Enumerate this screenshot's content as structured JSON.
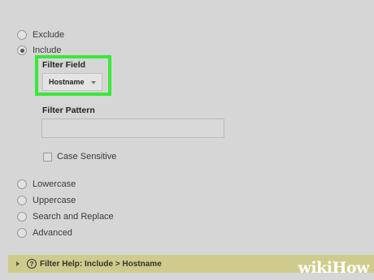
{
  "mode_options": [
    {
      "label": "Exclude",
      "selected": false
    },
    {
      "label": "Include",
      "selected": true
    }
  ],
  "filter_field": {
    "title": "Filter Field",
    "selected_value": "Hostname",
    "highlight_color": "#39e83a"
  },
  "filter_pattern": {
    "title": "Filter Pattern",
    "value": ""
  },
  "case_sensitive": {
    "label": "Case Sensitive",
    "checked": false
  },
  "action_options": [
    {
      "label": "Lowercase",
      "selected": false
    },
    {
      "label": "Uppercase",
      "selected": false
    },
    {
      "label": "Search and Replace",
      "selected": false
    },
    {
      "label": "Advanced",
      "selected": false
    }
  ],
  "help_bar": {
    "icon_glyph": "?",
    "text": "Filter Help: Include > Hostname",
    "background": "#cfcb8c"
  },
  "watermark": {
    "wiki": "wiki",
    "how": "How"
  }
}
